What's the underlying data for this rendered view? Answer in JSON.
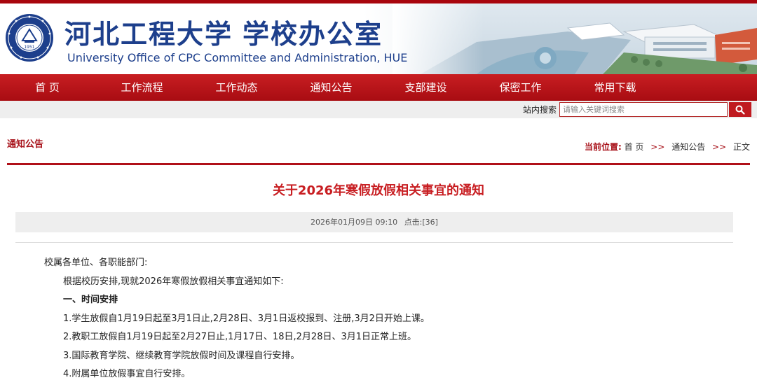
{
  "header": {
    "title_cn": "河北工程大学",
    "office_cn": "学校办公室",
    "title_en": "University Office of CPC Committee and Administration, HUE",
    "seal_inner": "1951",
    "seal_ring_text": "河北工程大学 HEBEI UNIVERSITY OF ENGINEERING"
  },
  "nav": {
    "items": [
      {
        "label": "首 页"
      },
      {
        "label": "工作流程"
      },
      {
        "label": "工作动态"
      },
      {
        "label": "通知公告"
      },
      {
        "label": "支部建设"
      },
      {
        "label": "保密工作"
      },
      {
        "label": "常用下载"
      }
    ]
  },
  "search": {
    "label": "站内搜索",
    "placeholder": "请输入关键词搜索",
    "value": ""
  },
  "section": {
    "title": "通知公告",
    "breadcrumb": {
      "label": "当前位置:",
      "items": [
        "首 页",
        "通知公告",
        "正文"
      ],
      "separator": ">>"
    }
  },
  "article": {
    "title": "关于2026年寒假放假相关事宜的通知",
    "date": "2026年01月09日 09:10",
    "clicks": "点击:[36]",
    "salutation": "校属各单位、各职能部门:",
    "intro": "根据校历安排,现就2026年寒假放假相关事宜通知如下:",
    "section1_heading": "一、时间安排",
    "items": [
      "1.学生放假自1月19日起至3月1日止,2月28日、3月1日返校报到、注册,3月2日开始上课。",
      "2.教职工放假自1月19日起至2月27日止,1月17日、18日,2月28日、3月1日正常上班。",
      "3.国际教育学院、继续教育学院放假时间及课程自行安排。",
      "4.附属单位放假事宜自行安排。"
    ]
  },
  "colors": {
    "brand_red": "#c81e22",
    "title_blue": "#1d3f8c"
  }
}
